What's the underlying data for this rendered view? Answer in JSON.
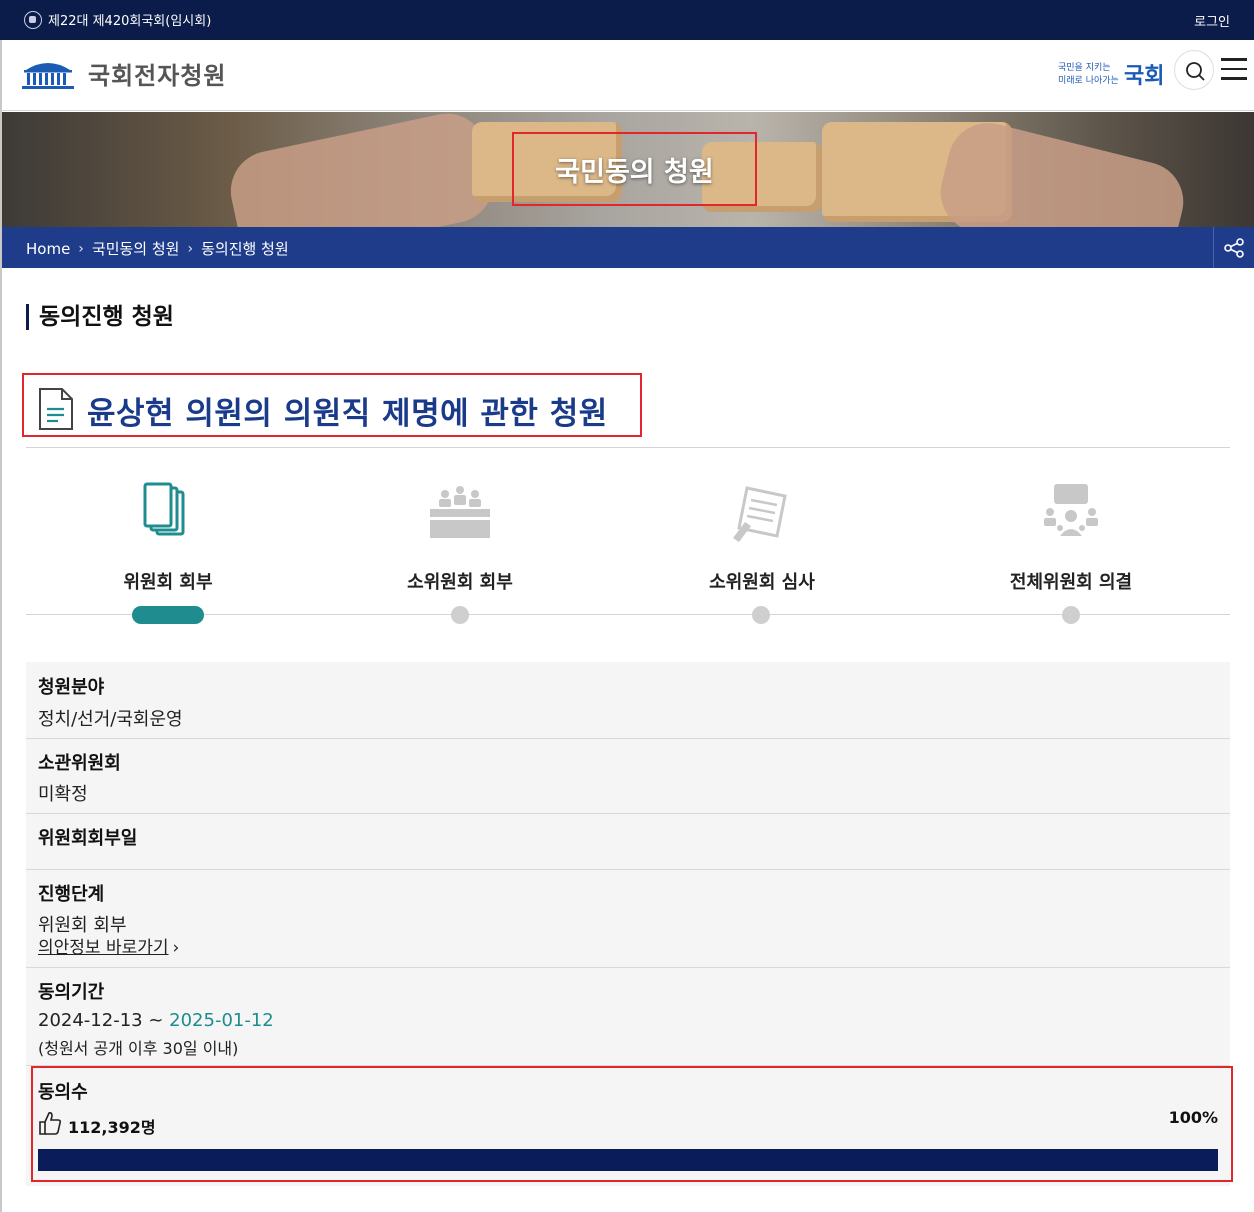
{
  "topbar": {
    "session": "제22대 제420회국회(임시회)",
    "login": "로그인"
  },
  "header": {
    "site_title": "국회전자청원",
    "slogan_line1": "국민을 지키는",
    "slogan_line2": "미래로 나아가는",
    "slogan_big": "국회",
    "icons": [
      "assembly-logo-icon",
      "search-icon",
      "menu-icon"
    ]
  },
  "hero": {
    "title": "국민동의 청원"
  },
  "breadcrumb": {
    "items": [
      "Home",
      "국민동의 청원",
      "동의진행 청원"
    ],
    "share_icon": "share-icon"
  },
  "section": {
    "title": "동의진행 청원"
  },
  "petition": {
    "title": "윤상현 의원의 의원직 제명에 관한 청원"
  },
  "steps": [
    {
      "label": "위원회 회부",
      "icon": "documents-icon",
      "active": true
    },
    {
      "label": "소위원회 회부",
      "icon": "meeting-icon",
      "active": false
    },
    {
      "label": "소위원회 심사",
      "icon": "review-icon",
      "active": false
    },
    {
      "label": "전체위원회 의결",
      "icon": "conference-icon",
      "active": false
    }
  ],
  "info": {
    "field": {
      "label": "청원분야",
      "value": "정치/선거/국회운영"
    },
    "committee": {
      "label": "소관위원회",
      "value": "미확정"
    },
    "referral_date": {
      "label": "위원회회부일",
      "value": ""
    },
    "stage": {
      "label": "진행단계",
      "value": "위원회 회부",
      "link": "의안정보 바로가기"
    },
    "period": {
      "label": "동의기간",
      "start": "2024-12-13",
      "sep": " ~ ",
      "end": "2025-01-12",
      "note": "(청원서 공개 이후 30일 이내)"
    },
    "votes": {
      "label": "동의수",
      "count": "112,392명",
      "percent_text": "100%",
      "progress": 1.0
    }
  },
  "colors": {
    "topbar": "#0b1c4a",
    "breadcrumb": "#1f3c8a",
    "accent_teal": "#1f8c8f",
    "progress": "#0b1c5a",
    "highlight_red": "#e3262b"
  }
}
